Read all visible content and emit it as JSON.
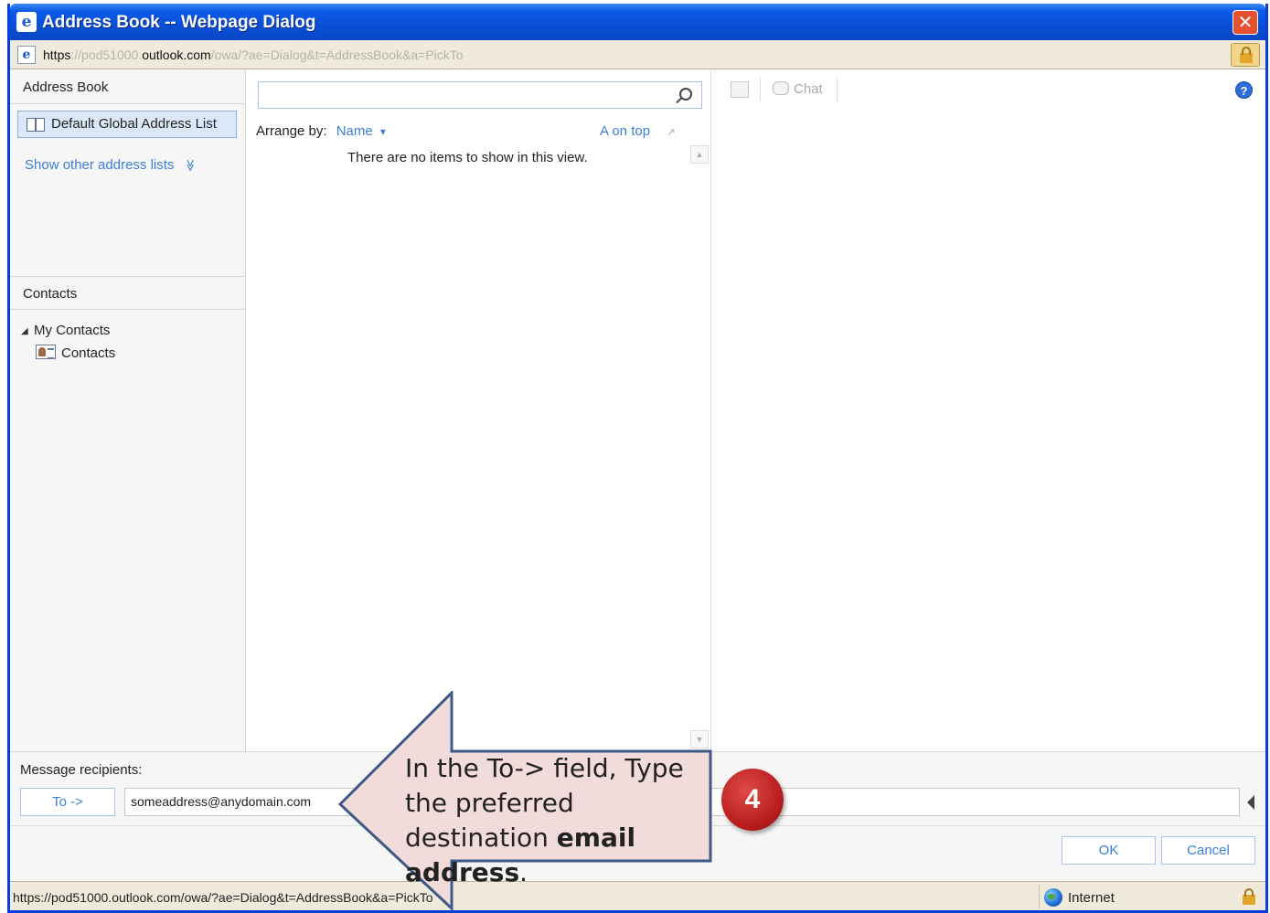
{
  "window": {
    "title": "Address Book -- Webpage Dialog",
    "close_label": "✕"
  },
  "address_bar": {
    "url_scheme": "https",
    "url_sep": "://",
    "url_sub": "pod51000.",
    "url_domain": "outlook.com",
    "url_path": "/owa/?ae=Dialog&t=AddressBook&a=PickTo"
  },
  "left_panel": {
    "address_book_header": "Address Book",
    "selected_list": "Default Global Address List",
    "show_other_link": "Show other address lists",
    "show_other_chevron": "≫",
    "contacts_header": "Contacts",
    "tree_expand_arrow": "◢",
    "tree_root": "My Contacts",
    "tree_child": "Contacts"
  },
  "middle_panel": {
    "search_value": "",
    "arrange_label": "Arrange by:",
    "arrange_value": "Name",
    "arrange_caret": "▾",
    "sort_order": "A on top",
    "sort_arrow": "↗",
    "empty_message": "There are no items to show in this view.",
    "scroll_up": "▲",
    "scroll_down": "▼"
  },
  "right_panel": {
    "chat_label": "Chat",
    "help_label": "?"
  },
  "bottom": {
    "recipients_label": "Message recipients:",
    "to_button": "To ->",
    "to_value": "someaddress@anydomain.com",
    "ok_button": "OK",
    "cancel_button": "Cancel"
  },
  "status_bar": {
    "url": "https://pod51000.outlook.com/owa/?ae=Dialog&t=AddressBook&a=PickTo",
    "zone": "Internet"
  },
  "callout": {
    "line1": "In the To-> field, Type the preferred destination ",
    "bold": "email address",
    "end": ".",
    "step_number": "4",
    "fill_color": "#f2dcdb",
    "stroke_color": "#3e5a86",
    "badge_color": "#c0282a"
  },
  "icons": {
    "app": "ie-page-icon",
    "close": "close-icon",
    "lock": "lock-icon",
    "search": "search-icon",
    "book": "address-book-icon",
    "contacts": "contacts-card-icon",
    "help": "help-icon",
    "globe": "globe-icon",
    "chat": "chat-icon"
  }
}
